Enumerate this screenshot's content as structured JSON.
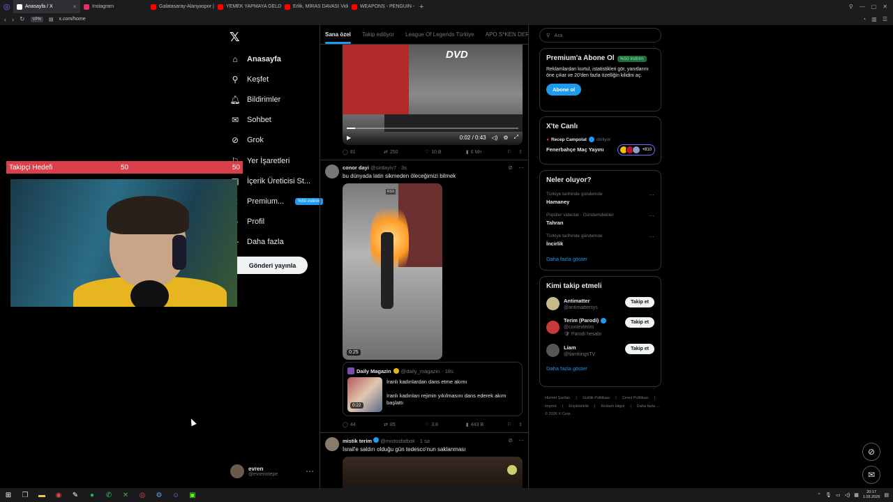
{
  "browser": {
    "tabs": [
      {
        "label": "Anasayfa / X",
        "active": true,
        "color": "#ffffff"
      },
      {
        "label": "Instagram",
        "active": false,
        "color": "#e1306c"
      },
      {
        "label": "Galatasaray-Alanyaspor |",
        "active": false,
        "color": "#ff0000"
      },
      {
        "label": "YEMEK YAPMAYA GELDİ",
        "active": false,
        "color": "#ff0000"
      },
      {
        "label": "Erlik, MİRAS DAVASI Vide",
        "active": false,
        "color": "#ff0000"
      },
      {
        "label": "WEAPONS - PENGUIN - S",
        "active": false,
        "color": "#ff0000"
      }
    ],
    "url": "x.com/home",
    "vpn": "VPN"
  },
  "nav": {
    "items": [
      {
        "label": "Anasayfa",
        "icon": "home-icon",
        "glyph": "⌂"
      },
      {
        "label": "Keşfet",
        "icon": "search-icon",
        "glyph": "⚲"
      },
      {
        "label": "Bildirimler",
        "icon": "bell-icon",
        "glyph": "🔔︎"
      },
      {
        "label": "Sohbet",
        "icon": "mail-icon",
        "glyph": "✉"
      },
      {
        "label": "Grok",
        "icon": "grok-icon",
        "glyph": "⊘"
      },
      {
        "label": "Yer İşaretleri",
        "icon": "bookmark-icon",
        "glyph": "⚐"
      },
      {
        "label": "İçerik Üreticisi St...",
        "icon": "studio-icon",
        "glyph": "▦"
      },
      {
        "label": "Premium...",
        "icon": "x-premium-icon",
        "glyph": "✕"
      },
      {
        "label": "Profil",
        "icon": "person-icon",
        "glyph": "☺"
      },
      {
        "label": "Daha fazla",
        "icon": "more-circle-icon",
        "glyph": "⋯"
      }
    ],
    "premium_badge": "%50 indirim",
    "post_button": "Gönderi yayınla",
    "profile": {
      "name": "evren",
      "handle": "@evrenntepe"
    }
  },
  "overlay": {
    "goal_label": "Takipçi Hedefi",
    "goal_current": "50",
    "goal_target": "50"
  },
  "timeline": {
    "tabs": [
      "Sana özel",
      "Takip ediliyor",
      "League Of Legends Türkiye",
      "APO S*KEN DERNE"
    ],
    "post1": {
      "dvd_logo": "DVD",
      "video_time": "0:02 / 0:43",
      "progress": 0.05,
      "stats": {
        "replies": "81",
        "reposts": "250",
        "likes": "10 B",
        "views": "6 Mn"
      }
    },
    "post2": {
      "name": "conor dayi",
      "handle": "@sirdayiv7",
      "time": "· 3s",
      "text": "bu dünyada latin sikmeden öleceğimizi bilmek",
      "media_duration": "0:25",
      "watermark": "RSX",
      "quote": {
        "name": "Daily Magazin",
        "handle": "@daily_magazin",
        "time": "· 18s",
        "line1": "İranlı kadınlardan dans etme akımı",
        "line2": "İranlı kadınları rejimin yıkılmasını dans ederek akım başlattı",
        "duration": "0:22"
      },
      "stats": {
        "replies": "44",
        "reposts": "85",
        "likes": "3.8",
        "views": "443 B"
      }
    },
    "post3": {
      "name": "mistik terim",
      "handle": "@mistosfatbok",
      "time": "· 1 sa",
      "text": "İsrail'e saldırı olduğu gün tedesco'nun saklanması"
    }
  },
  "sidebar": {
    "search_placeholder": "Ara",
    "premium": {
      "title": "Premium'a Abone Ol",
      "badge": "%50 indirim",
      "text": "Reklamlardan kurtul, istatistikleri gör, yanıtlarını öne çıkar ve 20'den fazla özelliğin kilidini aç.",
      "button": "Abone ol"
    },
    "live": {
      "title": "X'te Canlı",
      "host": "Recep Campolat",
      "status": "dinliyor",
      "space_title": "Fenerbahçe Maç Yayını",
      "listeners": "+810"
    },
    "trends": {
      "title": "Neler oluyor?",
      "items": [
        {
          "category": "Türkiye tarihinde gündemde",
          "topic": "Hamaney"
        },
        {
          "category": "Popüler videolar · Gündemdekiler",
          "topic": "Tahran"
        },
        {
          "category": "Türkiye tarihinde gündemde",
          "topic": "İncirlik"
        }
      ],
      "more": "Daha fazla göster"
    },
    "who_to_follow": {
      "title": "Kimi takip etmeli",
      "items": [
        {
          "name": "Antimatter",
          "handle": "@antimattersys",
          "sub": "",
          "button": "Takip et",
          "color": "#c7b98a",
          "verified": false
        },
        {
          "name": "Terim (Parodi)",
          "handle": "@contexterim",
          "sub": "🛡 Parodi hesabı",
          "button": "Takip et",
          "color": "#c83a3a",
          "verified": true
        },
        {
          "name": "Liam",
          "handle": "@liamkingsTV",
          "sub": "",
          "button": "Takip et",
          "color": "#555555",
          "verified": false
        }
      ],
      "more": "Daha fazla göster"
    },
    "footer": [
      "Hizmet Şartları",
      "|",
      "Gizlilik Politikası",
      "|",
      "Çerez Politikası",
      "|",
      "Imprint",
      "|",
      "Erişilebilirlik",
      "|",
      "Reklam bilgisi",
      "|",
      "Daha fazla ...",
      "© 2026 X Corp."
    ]
  },
  "taskbar": {
    "time": "20:17",
    "date": "1.03.2026"
  },
  "colors": {
    "accent": "#1d9bf0",
    "goal_bar": "#d9404a"
  }
}
